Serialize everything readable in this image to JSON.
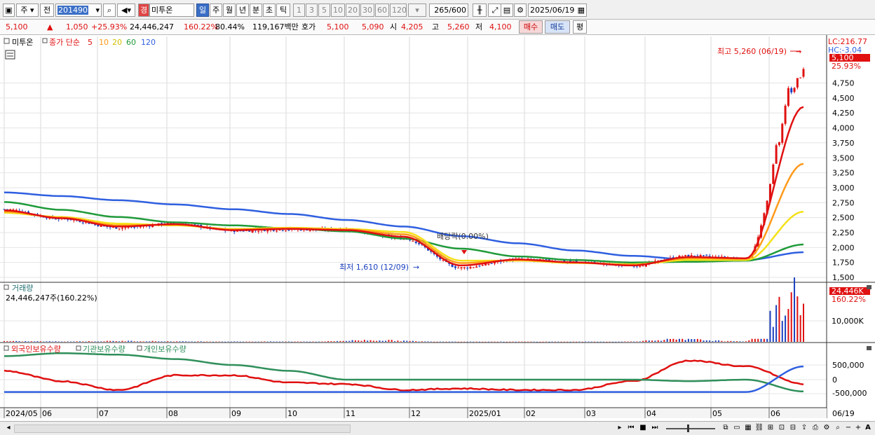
{
  "toolbar": {
    "market": "주",
    "prev": "전",
    "code": "201490",
    "badge": "경",
    "name": "미투온",
    "periods": [
      "일",
      "주",
      "월",
      "년",
      "분",
      "초",
      "틱"
    ],
    "intervals": [
      "1",
      "3",
      "5",
      "10",
      "20",
      "30",
      "60",
      "120"
    ],
    "count": "265",
    "count_max": "/600",
    "date": "2025/06/19"
  },
  "quote": {
    "price": "5,100",
    "change": "1,050",
    "change_pct": "+25.93%",
    "volume": "24,446,247",
    "vol_ratio": "160.22%",
    "turnover": "80.44%",
    "amount": "119,167백만",
    "hoga_label": "호가",
    "ask": "5,100",
    "bid": "5,090",
    "open_label": "시",
    "open": "4,205",
    "high_label": "고",
    "high": "5,260",
    "low_label": "저",
    "low": "4,100",
    "buy_label": "매수",
    "sell_label": "매도",
    "eval_label": "평"
  },
  "colors": {
    "up": "#e01010",
    "down": "#1a3fbf",
    "ma5": "#e01010",
    "ma10": "#ff9a1a",
    "ma20": "#f5e11a",
    "ma60": "#1f9a3a",
    "ma120": "#2f5fe0",
    "foreign": "#e01010",
    "institution": "#2f8f5a",
    "individual": "#2f5fe0"
  },
  "price_panel": {
    "stock_label": "미투온",
    "legend_prefix": "종가 단순",
    "ma_labels": [
      "5",
      "10",
      "20",
      "60",
      "120"
    ],
    "lc": "LC:216.77",
    "hc": "HC:-3.04",
    "last_price_tag": "5,100",
    "last_pct_tag": "25.93%",
    "high_annot": "최고 5,260 (06/19)",
    "low_annot": "최저 1,610 (12/09)",
    "dividend_annot": "배당락(0.00%)",
    "yticks": [
      "4,750",
      "4,500",
      "4,250",
      "4,000",
      "3,750",
      "3,500",
      "3,250",
      "3,000",
      "2,750",
      "2,500",
      "2,250",
      "2,000",
      "1,750",
      "1,500"
    ]
  },
  "volume_panel": {
    "title": "거래량",
    "value": "24,446,247주(160.22%)",
    "tag": "24,446K",
    "tag_pct": "160.22%",
    "ytick": "10,000K"
  },
  "holding_panel": {
    "legend": [
      "외국인보유수량",
      "기관보유수량",
      "개인보유수량"
    ],
    "yticks": [
      "500,000",
      "0",
      "-500,000"
    ]
  },
  "xaxis": {
    "labels": [
      "2024/05",
      "06",
      "07",
      "08",
      "09",
      "10",
      "11",
      "12",
      "2025/01",
      "02",
      "03",
      "04",
      "05",
      "06"
    ],
    "right_label": "06/19"
  },
  "chart_data": [
    {
      "type": "candlestick",
      "title": "",
      "x": [
        "2024/05",
        "06",
        "07",
        "08",
        "09",
        "10",
        "11",
        "12",
        "2025/01",
        "02",
        "03",
        "04",
        "05",
        "06"
      ],
      "series": [
        {
          "name": "종가",
          "values": [
            2640,
            2480,
            2330,
            2400,
            2280,
            2300,
            2300,
            2150,
            1660,
            1800,
            1760,
            1700,
            1860,
            1810,
            5100
          ]
        },
        {
          "name": "5",
          "values": [
            2620,
            2490,
            2350,
            2390,
            2290,
            2310,
            2290,
            2180,
            1700,
            1800,
            1750,
            1700,
            1840,
            1820,
            4350
          ]
        },
        {
          "name": "10",
          "values": [
            2600,
            2500,
            2370,
            2380,
            2300,
            2320,
            2300,
            2220,
            1740,
            1790,
            1750,
            1710,
            1820,
            1810,
            3400
          ]
        },
        {
          "name": "20",
          "values": [
            2580,
            2510,
            2400,
            2370,
            2310,
            2330,
            2310,
            2260,
            1780,
            1780,
            1740,
            1720,
            1790,
            1790,
            2600
          ]
        },
        {
          "name": "60",
          "values": [
            2760,
            2630,
            2510,
            2420,
            2370,
            2320,
            2270,
            2150,
            1980,
            1850,
            1790,
            1750,
            1760,
            1780,
            2050
          ]
        },
        {
          "name": "120",
          "values": [
            2920,
            2860,
            2790,
            2720,
            2640,
            2560,
            2460,
            2350,
            2190,
            2070,
            1950,
            1860,
            1800,
            1790,
            1920
          ]
        }
      ],
      "ylim": [
        1500,
        5260
      ],
      "high": {
        "value": 5260,
        "date": "06/19"
      },
      "low": {
        "value": 1610,
        "date": "12/09"
      }
    },
    {
      "type": "bar",
      "title": "거래량",
      "x": [
        "2024/05",
        "06",
        "07",
        "08",
        "09",
        "10",
        "11",
        "12",
        "2025/01",
        "02",
        "03",
        "04",
        "05",
        "06"
      ],
      "values_k": [
        300,
        200,
        400,
        200,
        150,
        150,
        800,
        150,
        100,
        100,
        100,
        1200,
        200,
        24446
      ]
    },
    {
      "type": "line",
      "title": "보유수량",
      "x": [
        "2024/05",
        "06",
        "07",
        "08",
        "09",
        "10",
        "11",
        "12",
        "2025/01",
        "02",
        "03",
        "04",
        "05",
        "06"
      ],
      "series": [
        {
          "name": "외국인보유수량",
          "values": [
            300000,
            -50000,
            -350000,
            150000,
            150000,
            -100000,
            -150000,
            -350000,
            -300000,
            -350000,
            -350000,
            -50000,
            650000,
            450000,
            -150000
          ]
        },
        {
          "name": "기관보유수량",
          "values": [
            800000,
            900000,
            850000,
            700000,
            500000,
            300000,
            0,
            0,
            0,
            0,
            0,
            0,
            -50000,
            0,
            -400000
          ]
        },
        {
          "name": "개인보유수량",
          "values": [
            -420000,
            -420000,
            -420000,
            -420000,
            -420000,
            -420000,
            -420000,
            -420000,
            -420000,
            -420000,
            -420000,
            -420000,
            -420000,
            -420000,
            450000
          ]
        }
      ]
    }
  ],
  "bottom": {
    "zoom_label": "A"
  }
}
